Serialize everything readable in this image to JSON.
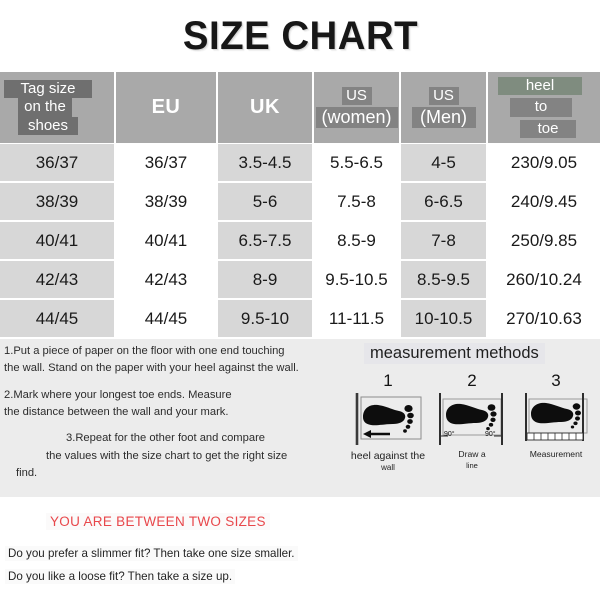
{
  "title": "SIZE CHART",
  "table": {
    "headers": [
      {
        "name": "tag-size",
        "type": "stacked",
        "align": "left",
        "lines": [
          "Tag size",
          "on the",
          "shoes"
        ],
        "highlight": "dark"
      },
      {
        "name": "eu",
        "type": "plain",
        "label": "EU"
      },
      {
        "name": "uk",
        "type": "plain",
        "label": "UK"
      },
      {
        "name": "us-women",
        "type": "stacked",
        "align": "center",
        "lines": [
          "US",
          "(women)"
        ],
        "highlight": "mid"
      },
      {
        "name": "us-men",
        "type": "stacked",
        "align": "center",
        "lines": [
          "US",
          "(Men)"
        ],
        "highlight": "mid"
      },
      {
        "name": "heel-to-toe",
        "type": "stacked",
        "align": "right",
        "lines": [
          "heel",
          "to",
          "toe"
        ],
        "highlight": "green"
      }
    ],
    "rows": [
      [
        "36/37",
        "36/37",
        "3.5-4.5",
        "5.5-6.5",
        "4-5",
        "230/9.05"
      ],
      [
        "38/39",
        "38/39",
        "5-6",
        "7.5-8",
        "6-6.5",
        "240/9.45"
      ],
      [
        "40/41",
        "40/41",
        "6.5-7.5",
        "8.5-9",
        "7-8",
        "250/9.85"
      ],
      [
        "42/43",
        "42/43",
        "8-9",
        "9.5-10.5",
        "8.5-9.5",
        "260/10.24"
      ],
      [
        "44/45",
        "44/45",
        "9.5-10",
        "11-11.5",
        "10-10.5",
        "270/10.63"
      ]
    ]
  },
  "instructions": {
    "step1_line1": "1.Put a piece of paper on the floor with one end touching",
    "step1_line2": "the wall. Stand on the paper with your heel against the wall.",
    "step2_line1": "2.Mark where your longest toe ends. Measure",
    "step2_line2": "the distance between the wall and your mark.",
    "step3_line1": "3.Repeat for the other foot and compare",
    "step3_line2": "the values with the size chart to get the right size",
    "step3_line3": "find."
  },
  "methods": {
    "title": "measurement methods",
    "diagrams": [
      {
        "number": "1",
        "caption_main": "heel against the",
        "caption_sub": "wall"
      },
      {
        "number": "2",
        "caption_main": "Draw a",
        "caption_sub": "line",
        "angle_left": "90°",
        "angle_right": "90°"
      },
      {
        "number": "3",
        "caption_main": "Measurement",
        "caption_sub": ""
      }
    ]
  },
  "footer": {
    "between_sizes": "YOU ARE BETWEEN TWO SIZES",
    "fit_slimmer": "Do you prefer a slimmer fit? Then take one size smaller.",
    "fit_loose": "Do you like a loose fit? Then take a size up."
  },
  "colors": {
    "header_bg": "#a9a9a9",
    "highlight_dark": "#6f6f6f",
    "highlight_green": "#7f8c7f",
    "row_shade": "#d7d7d7",
    "panel_bg": "#ececec",
    "accent_red": "#e8474b"
  }
}
